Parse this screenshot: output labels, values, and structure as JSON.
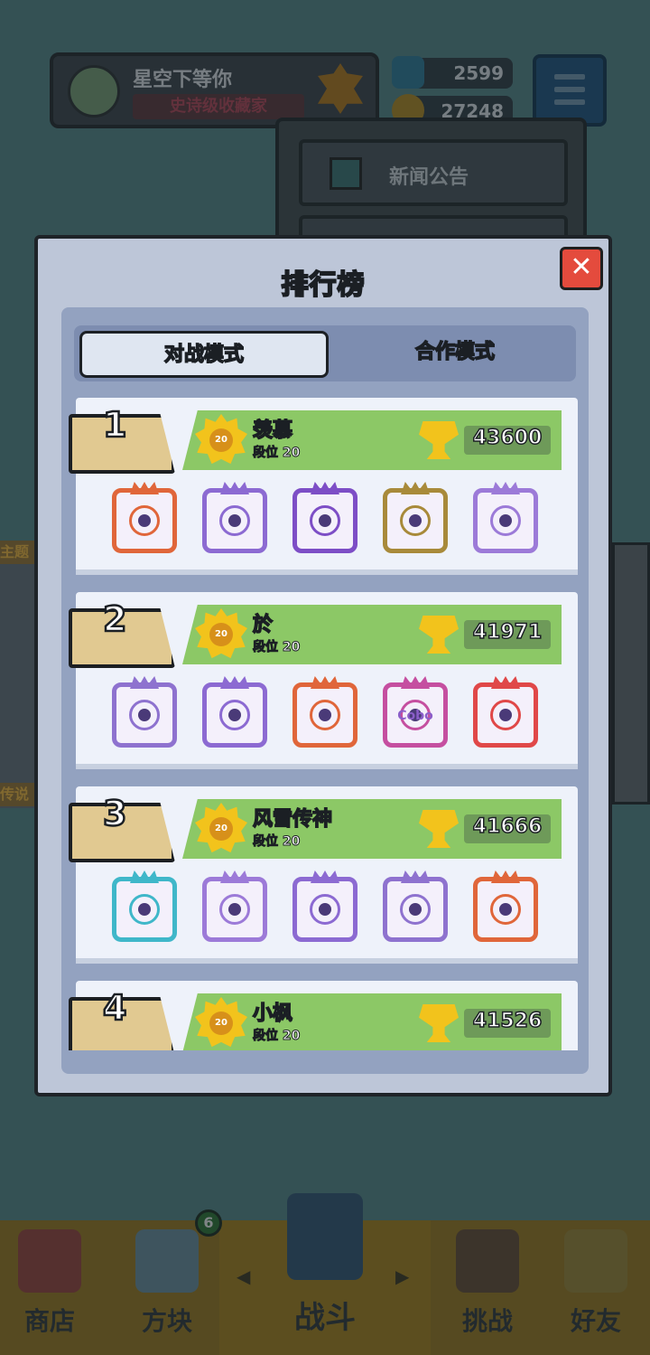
{
  "background": {
    "profile": {
      "name": "星空下等你",
      "title": "史诗级收藏家"
    },
    "currency": [
      {
        "icon": "gem-icon",
        "value": "2599",
        "color": "#2d6f8a"
      },
      {
        "icon": "coin-icon",
        "value": "27248",
        "color": "#a17d22"
      }
    ],
    "dropdown": {
      "items": [
        {
          "label": "新闻公告",
          "icon": "monitor-icon"
        }
      ]
    },
    "side_left_tags": [
      "主题",
      "传说"
    ]
  },
  "panel": {
    "title": "排行榜",
    "close_label": "✕",
    "tabs": [
      {
        "label": "对战模式",
        "active": true
      },
      {
        "label": "合作模式",
        "active": false
      }
    ],
    "entries": [
      {
        "rank": "1",
        "name": "羡慕",
        "tier": "段位 20",
        "medal": "20",
        "score": "43600",
        "dice": [
          {
            "kind": "rainbow-infinity",
            "color": "#e0663a",
            "label": ""
          },
          {
            "kind": "purple-ring",
            "color": "#8c6ad2",
            "label": ""
          },
          {
            "kind": "purple-atom",
            "color": "#7d4ec6",
            "label": ""
          },
          {
            "kind": "gold-shield",
            "color": "#a88a3a",
            "label": ""
          },
          {
            "kind": "purple-gear",
            "color": "#9c7ad8",
            "label": ""
          }
        ]
      },
      {
        "rank": "2",
        "name": "於",
        "tier": "段位 20",
        "medal": "20",
        "score": "41971",
        "dice": [
          {
            "kind": "lightning",
            "color": "#8e72cf",
            "label": ""
          },
          {
            "kind": "purple-ring",
            "color": "#8c6ad2",
            "label": ""
          },
          {
            "kind": "rainbow-infinity",
            "color": "#e0663a",
            "label": ""
          },
          {
            "kind": "combo",
            "color": "#c54fa0",
            "label": "Cobo"
          },
          {
            "kind": "rainbow",
            "color": "#e04848",
            "label": ""
          }
        ]
      },
      {
        "rank": "3",
        "name": "风雪传神",
        "tier": "段位 20",
        "medal": "20",
        "score": "41666",
        "dice": [
          {
            "kind": "ice-dragon",
            "color": "#3fb7c9",
            "label": ""
          },
          {
            "kind": "purple-gear",
            "color": "#9c7ad8",
            "label": ""
          },
          {
            "kind": "purple-ring",
            "color": "#8c6ad2",
            "label": ""
          },
          {
            "kind": "lightning",
            "color": "#8e72cf",
            "label": ""
          },
          {
            "kind": "rainbow-infinity",
            "color": "#e0663a",
            "label": ""
          }
        ]
      },
      {
        "rank": "4",
        "name": "小枫",
        "tier": "段位 20",
        "medal": "20",
        "score": "41526",
        "dice": []
      }
    ]
  },
  "bottom_nav": {
    "items": [
      {
        "label": "商店",
        "icon": "shop-icon",
        "color": "#c0504a"
      },
      {
        "label": "方块",
        "icon": "dice-box-icon",
        "color": "#7aa0b8"
      },
      {
        "label": "战斗",
        "icon": "battle-shield-icon",
        "color": "#3c6f9e"
      },
      {
        "label": "挑战",
        "icon": "challenge-castle-icon",
        "color": "#8a5a3a"
      },
      {
        "label": "好友",
        "icon": "friends-icon",
        "color": "#c9a646"
      }
    ],
    "badge": "6",
    "left_arrow": "◀",
    "right_arrow": "▶"
  }
}
